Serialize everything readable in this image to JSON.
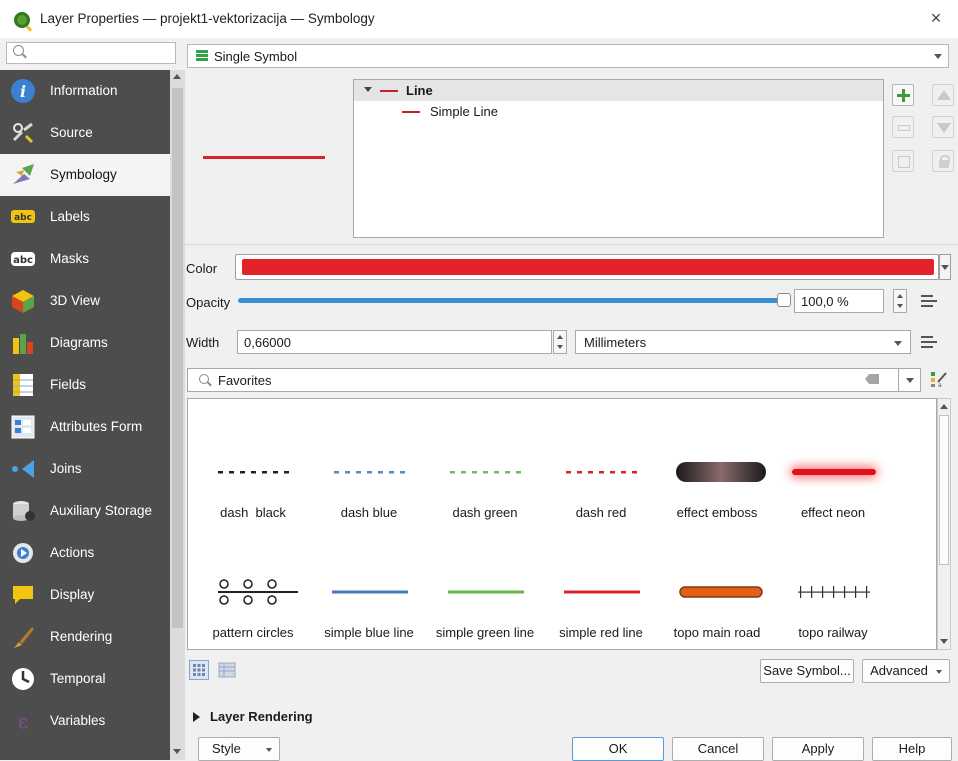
{
  "window": {
    "title": "Layer Properties — projekt1-vektorizacija — Symbology",
    "close_glyph": "×"
  },
  "sidebar": {
    "search_placeholder": "",
    "items": [
      {
        "label": "Information",
        "icon": "info-icon",
        "active": false
      },
      {
        "label": "Source",
        "icon": "source-icon",
        "active": false
      },
      {
        "label": "Symbology",
        "icon": "symbology-icon",
        "active": true
      },
      {
        "label": "Labels",
        "icon": "labels-icon",
        "active": false
      },
      {
        "label": "Masks",
        "icon": "masks-icon",
        "active": false
      },
      {
        "label": "3D View",
        "icon": "3d-view-icon",
        "active": false
      },
      {
        "label": "Diagrams",
        "icon": "diagrams-icon",
        "active": false
      },
      {
        "label": "Fields",
        "icon": "fields-icon",
        "active": false
      },
      {
        "label": "Attributes Form",
        "icon": "attributes-form-icon",
        "active": false
      },
      {
        "label": "Joins",
        "icon": "joins-icon",
        "active": false
      },
      {
        "label": "Auxiliary Storage",
        "icon": "auxiliary-storage-icon",
        "active": false
      },
      {
        "label": "Actions",
        "icon": "actions-icon",
        "active": false
      },
      {
        "label": "Display",
        "icon": "display-icon",
        "active": false
      },
      {
        "label": "Rendering",
        "icon": "rendering-icon",
        "active": false
      },
      {
        "label": "Temporal",
        "icon": "temporal-icon",
        "active": false
      },
      {
        "label": "Variables",
        "icon": "variables-icon",
        "active": false
      }
    ]
  },
  "symbology": {
    "renderer": "Single Symbol",
    "tree": {
      "root": "Line",
      "child": "Simple Line"
    },
    "color_label": "Color",
    "color_value": "#e3222a",
    "opacity_label": "Opacity",
    "opacity_value": "100,0 %",
    "opacity_fraction": 1.0,
    "width_label": "Width",
    "width_value": "0,66000",
    "unit": "Millimeters",
    "favorites_search": "Favorites",
    "gallery": [
      {
        "name": "dash  black",
        "kind": "dash",
        "color": "#222222"
      },
      {
        "name": "dash blue",
        "kind": "dash",
        "color": "#5b86c4"
      },
      {
        "name": "dash green",
        "kind": "dash",
        "color": "#6bbf5a"
      },
      {
        "name": "dash red",
        "kind": "dash",
        "color": "#d8232a"
      },
      {
        "name": "effect emboss",
        "kind": "emboss",
        "color": "#5a3a3a"
      },
      {
        "name": "effect neon",
        "kind": "neon",
        "color": "#e0111b"
      },
      {
        "name": "pattern circles",
        "kind": "circles",
        "color": "#222222"
      },
      {
        "name": "simple blue line",
        "kind": "solid",
        "color": "#4a78b8"
      },
      {
        "name": "simple green line",
        "kind": "solid",
        "color": "#63b84f"
      },
      {
        "name": "simple red line",
        "kind": "solid",
        "color": "#d8232a"
      },
      {
        "name": "topo main road",
        "kind": "road",
        "color": "#e85d16"
      },
      {
        "name": "topo railway",
        "kind": "railway",
        "color": "#333333"
      }
    ],
    "save_symbol": "Save Symbol...",
    "advanced": "Advanced",
    "layer_rendering": "Layer Rendering"
  },
  "footer": {
    "style": "Style",
    "ok": "OK",
    "cancel": "Cancel",
    "apply": "Apply",
    "help": "Help"
  }
}
